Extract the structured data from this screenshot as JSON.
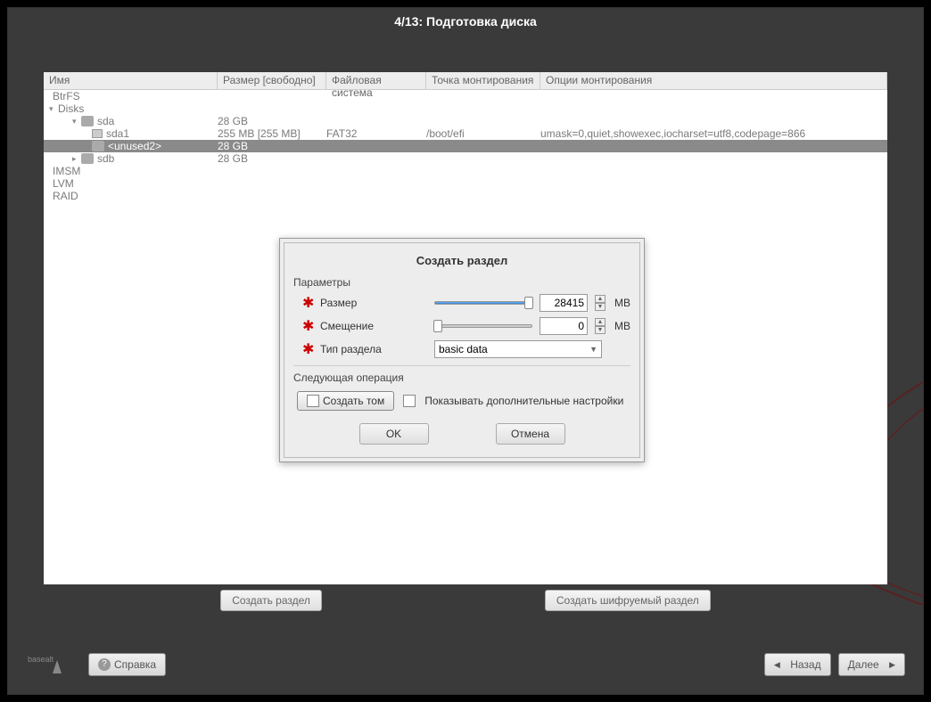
{
  "page_title": "4/13: Подготовка диска",
  "columns": {
    "name": "Имя",
    "size": "Размер [свободно]",
    "fs": "Файловая система",
    "mount": "Точка монтирования",
    "opts": "Опции монтирования"
  },
  "tree": {
    "btrfs": "BtrFS",
    "disks": "Disks",
    "sda": {
      "name": "sda",
      "size": "28 GB"
    },
    "sda1": {
      "name": "sda1",
      "size": "255 MB [255 MB]",
      "fs": "FAT32",
      "mount": "/boot/efi",
      "opts": "umask=0,quiet,showexec,iocharset=utf8,codepage=866"
    },
    "unused2": {
      "name": "<unused2>",
      "size": "28 GB"
    },
    "sdb": {
      "name": "sdb",
      "size": "28 GB"
    },
    "imsm": "IMSM",
    "lvm": "LVM",
    "raid": "RAID"
  },
  "action_buttons": {
    "create_partition": "Создать раздел",
    "create_encrypted": "Создать шифруемый раздел"
  },
  "footer": {
    "help": "Справка",
    "back": "Назад",
    "next": "Далее"
  },
  "dialog": {
    "title": "Создать раздел",
    "params_label": "Параметры",
    "size_label": "Размер",
    "size_value": "28415",
    "size_unit": "MB",
    "offset_label": "Смещение",
    "offset_value": "0",
    "offset_unit": "MB",
    "type_label": "Тип раздела",
    "type_value": "basic data",
    "next_op_label": "Следующая операция",
    "create_volume": "Создать том",
    "show_advanced": "Показывать дополнительные настройки",
    "ok": "OK",
    "cancel": "Отмена"
  }
}
